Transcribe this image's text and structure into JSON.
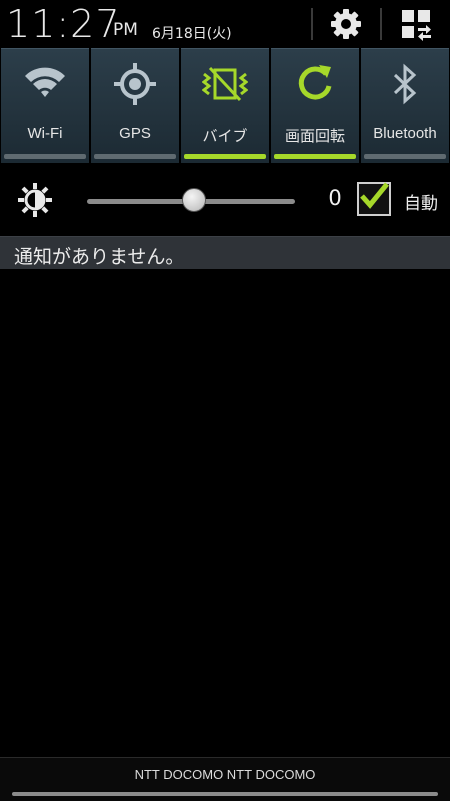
{
  "header": {
    "time": "11:27",
    "ampm": "PM",
    "date": "6月18日(火)",
    "settings_icon": "gear-icon",
    "grid_icon": "quick-panel-edit-icon"
  },
  "toggles": [
    {
      "label": "Wi-Fi",
      "icon": "wifi-icon",
      "on": false
    },
    {
      "label": "GPS",
      "icon": "gps-icon",
      "on": false
    },
    {
      "label": "バイブ",
      "icon": "vibrate-icon",
      "on": true
    },
    {
      "label": "画面回転",
      "icon": "rotate-icon",
      "on": true
    },
    {
      "label": "Bluetooth",
      "icon": "bluetooth-icon",
      "on": false
    }
  ],
  "brightness": {
    "icon": "brightness-icon",
    "level_fraction": 0.51,
    "value": "0",
    "auto_label": "自動",
    "auto_checked": true
  },
  "notifications": {
    "empty_text": "通知がありません。"
  },
  "footer": {
    "carrier": "NTT DOCOMO NTT DOCOMO"
  },
  "colors": {
    "accent": "#a6d82a",
    "toggle_bg": "#243540",
    "inactive_icon": "#b8c4cc"
  }
}
